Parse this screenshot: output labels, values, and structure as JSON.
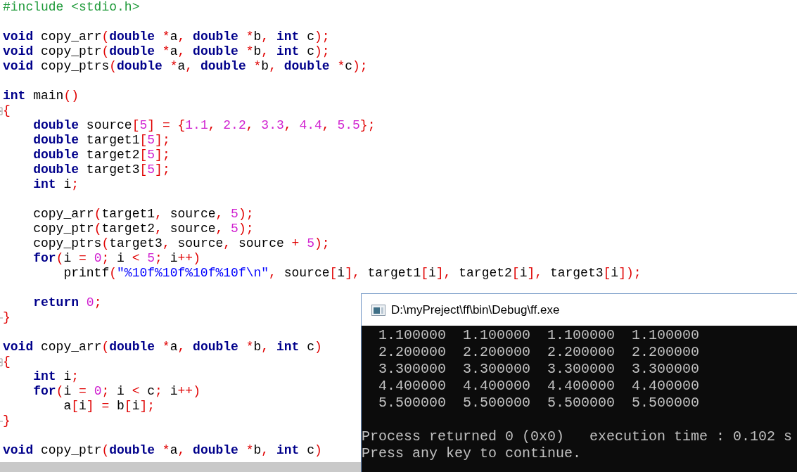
{
  "editor": {
    "lines": [
      {
        "kind": "code",
        "tokens": [
          {
            "kind": "pre",
            "text": "#include <stdio.h>"
          }
        ]
      },
      {
        "kind": "blank"
      },
      {
        "kind": "code",
        "tokens": [
          {
            "kind": "kw",
            "text": "void"
          },
          {
            "kind": "id",
            "text": " copy_arr"
          },
          {
            "kind": "op",
            "text": "("
          },
          {
            "kind": "kw",
            "text": "double"
          },
          {
            "kind": "op",
            "text": " *"
          },
          {
            "kind": "id",
            "text": "a"
          },
          {
            "kind": "op",
            "text": ","
          },
          {
            "kind": "kw",
            "text": " double"
          },
          {
            "kind": "op",
            "text": " *"
          },
          {
            "kind": "id",
            "text": "b"
          },
          {
            "kind": "op",
            "text": ","
          },
          {
            "kind": "kw",
            "text": " int"
          },
          {
            "kind": "id",
            "text": " c"
          },
          {
            "kind": "op",
            "text": ");"
          }
        ]
      },
      {
        "kind": "code",
        "tokens": [
          {
            "kind": "kw",
            "text": "void"
          },
          {
            "kind": "id",
            "text": " copy_ptr"
          },
          {
            "kind": "op",
            "text": "("
          },
          {
            "kind": "kw",
            "text": "double"
          },
          {
            "kind": "op",
            "text": " *"
          },
          {
            "kind": "id",
            "text": "a"
          },
          {
            "kind": "op",
            "text": ","
          },
          {
            "kind": "kw",
            "text": " double"
          },
          {
            "kind": "op",
            "text": " *"
          },
          {
            "kind": "id",
            "text": "b"
          },
          {
            "kind": "op",
            "text": ","
          },
          {
            "kind": "kw",
            "text": " int"
          },
          {
            "kind": "id",
            "text": " c"
          },
          {
            "kind": "op",
            "text": ");"
          }
        ]
      },
      {
        "kind": "code",
        "tokens": [
          {
            "kind": "kw",
            "text": "void"
          },
          {
            "kind": "id",
            "text": " copy_ptrs"
          },
          {
            "kind": "op",
            "text": "("
          },
          {
            "kind": "kw",
            "text": "double"
          },
          {
            "kind": "op",
            "text": " *"
          },
          {
            "kind": "id",
            "text": "a"
          },
          {
            "kind": "op",
            "text": ","
          },
          {
            "kind": "kw",
            "text": " double"
          },
          {
            "kind": "op",
            "text": " *"
          },
          {
            "kind": "id",
            "text": "b"
          },
          {
            "kind": "op",
            "text": ","
          },
          {
            "kind": "kw",
            "text": " double"
          },
          {
            "kind": "op",
            "text": " *"
          },
          {
            "kind": "id",
            "text": "c"
          },
          {
            "kind": "op",
            "text": ");"
          }
        ]
      },
      {
        "kind": "blank"
      },
      {
        "kind": "code",
        "tokens": [
          {
            "kind": "kw",
            "text": "int"
          },
          {
            "kind": "id",
            "text": " main"
          },
          {
            "kind": "op",
            "text": "()"
          }
        ]
      },
      {
        "kind": "block_open",
        "tokens": [
          {
            "kind": "op",
            "text": "{"
          }
        ]
      },
      {
        "kind": "code",
        "tokens": [
          {
            "kind": "kw",
            "text": "    double"
          },
          {
            "kind": "id",
            "text": " source"
          },
          {
            "kind": "op",
            "text": "["
          },
          {
            "kind": "num",
            "text": "5"
          },
          {
            "kind": "op",
            "text": "] = {"
          },
          {
            "kind": "num",
            "text": "1.1"
          },
          {
            "kind": "op",
            "text": ","
          },
          {
            "kind": "num",
            "text": " 2.2"
          },
          {
            "kind": "op",
            "text": ","
          },
          {
            "kind": "num",
            "text": " 3.3"
          },
          {
            "kind": "op",
            "text": ","
          },
          {
            "kind": "num",
            "text": " 4.4"
          },
          {
            "kind": "op",
            "text": ","
          },
          {
            "kind": "num",
            "text": " 5.5"
          },
          {
            "kind": "op",
            "text": "};"
          }
        ]
      },
      {
        "kind": "code",
        "tokens": [
          {
            "kind": "kw",
            "text": "    double"
          },
          {
            "kind": "id",
            "text": " target1"
          },
          {
            "kind": "op",
            "text": "["
          },
          {
            "kind": "num",
            "text": "5"
          },
          {
            "kind": "op",
            "text": "];"
          }
        ]
      },
      {
        "kind": "code",
        "tokens": [
          {
            "kind": "kw",
            "text": "    double"
          },
          {
            "kind": "id",
            "text": " target2"
          },
          {
            "kind": "op",
            "text": "["
          },
          {
            "kind": "num",
            "text": "5"
          },
          {
            "kind": "op",
            "text": "];"
          }
        ]
      },
      {
        "kind": "code",
        "tokens": [
          {
            "kind": "kw",
            "text": "    double"
          },
          {
            "kind": "id",
            "text": " target3"
          },
          {
            "kind": "op",
            "text": "["
          },
          {
            "kind": "num",
            "text": "5"
          },
          {
            "kind": "op",
            "text": "];"
          }
        ]
      },
      {
        "kind": "code",
        "tokens": [
          {
            "kind": "kw",
            "text": "    int"
          },
          {
            "kind": "id",
            "text": " i"
          },
          {
            "kind": "op",
            "text": ";"
          }
        ]
      },
      {
        "kind": "blank"
      },
      {
        "kind": "code",
        "tokens": [
          {
            "kind": "id",
            "text": "    copy_arr"
          },
          {
            "kind": "op",
            "text": "("
          },
          {
            "kind": "id",
            "text": "target1"
          },
          {
            "kind": "op",
            "text": ","
          },
          {
            "kind": "id",
            "text": " source"
          },
          {
            "kind": "op",
            "text": ","
          },
          {
            "kind": "num",
            "text": " 5"
          },
          {
            "kind": "op",
            "text": ");"
          }
        ]
      },
      {
        "kind": "code",
        "tokens": [
          {
            "kind": "id",
            "text": "    copy_ptr"
          },
          {
            "kind": "op",
            "text": "("
          },
          {
            "kind": "id",
            "text": "target2"
          },
          {
            "kind": "op",
            "text": ","
          },
          {
            "kind": "id",
            "text": " source"
          },
          {
            "kind": "op",
            "text": ","
          },
          {
            "kind": "num",
            "text": " 5"
          },
          {
            "kind": "op",
            "text": ");"
          }
        ]
      },
      {
        "kind": "code",
        "tokens": [
          {
            "kind": "id",
            "text": "    copy_ptrs"
          },
          {
            "kind": "op",
            "text": "("
          },
          {
            "kind": "id",
            "text": "target3"
          },
          {
            "kind": "op",
            "text": ","
          },
          {
            "kind": "id",
            "text": " source"
          },
          {
            "kind": "op",
            "text": ","
          },
          {
            "kind": "id",
            "text": " source"
          },
          {
            "kind": "op",
            "text": " +"
          },
          {
            "kind": "num",
            "text": " 5"
          },
          {
            "kind": "op",
            "text": ");"
          }
        ]
      },
      {
        "kind": "code",
        "tokens": [
          {
            "kind": "kw",
            "text": "    for"
          },
          {
            "kind": "op",
            "text": "("
          },
          {
            "kind": "id",
            "text": "i"
          },
          {
            "kind": "op",
            "text": " ="
          },
          {
            "kind": "num",
            "text": " 0"
          },
          {
            "kind": "op",
            "text": ";"
          },
          {
            "kind": "id",
            "text": " i"
          },
          {
            "kind": "op",
            "text": " <"
          },
          {
            "kind": "num",
            "text": " 5"
          },
          {
            "kind": "op",
            "text": ";"
          },
          {
            "kind": "id",
            "text": " i"
          },
          {
            "kind": "op",
            "text": "++)"
          }
        ]
      },
      {
        "kind": "code",
        "tokens": [
          {
            "kind": "id",
            "text": "        printf"
          },
          {
            "kind": "op",
            "text": "("
          },
          {
            "kind": "str",
            "text": "\"%10f%10f%10f%10f\\n\""
          },
          {
            "kind": "op",
            "text": ","
          },
          {
            "kind": "id",
            "text": " source"
          },
          {
            "kind": "op",
            "text": "["
          },
          {
            "kind": "id",
            "text": "i"
          },
          {
            "kind": "op",
            "text": "],"
          },
          {
            "kind": "id",
            "text": " target1"
          },
          {
            "kind": "op",
            "text": "["
          },
          {
            "kind": "id",
            "text": "i"
          },
          {
            "kind": "op",
            "text": "],"
          },
          {
            "kind": "id",
            "text": " target2"
          },
          {
            "kind": "op",
            "text": "["
          },
          {
            "kind": "id",
            "text": "i"
          },
          {
            "kind": "op",
            "text": "],"
          },
          {
            "kind": "id",
            "text": " target3"
          },
          {
            "kind": "op",
            "text": "["
          },
          {
            "kind": "id",
            "text": "i"
          },
          {
            "kind": "op",
            "text": "]);"
          }
        ]
      },
      {
        "kind": "blank"
      },
      {
        "kind": "code",
        "tokens": [
          {
            "kind": "kw",
            "text": "    return"
          },
          {
            "kind": "num",
            "text": " 0"
          },
          {
            "kind": "op",
            "text": ";"
          }
        ]
      },
      {
        "kind": "block_close",
        "tokens": [
          {
            "kind": "op",
            "text": "}"
          }
        ]
      },
      {
        "kind": "blank"
      },
      {
        "kind": "code",
        "tokens": [
          {
            "kind": "kw",
            "text": "void"
          },
          {
            "kind": "id",
            "text": " copy_arr"
          },
          {
            "kind": "op",
            "text": "("
          },
          {
            "kind": "kw",
            "text": "double"
          },
          {
            "kind": "op",
            "text": " *"
          },
          {
            "kind": "id",
            "text": "a"
          },
          {
            "kind": "op",
            "text": ","
          },
          {
            "kind": "kw",
            "text": " double"
          },
          {
            "kind": "op",
            "text": " *"
          },
          {
            "kind": "id",
            "text": "b"
          },
          {
            "kind": "op",
            "text": ","
          },
          {
            "kind": "kw",
            "text": " int"
          },
          {
            "kind": "id",
            "text": " c"
          },
          {
            "kind": "op",
            "text": ")"
          }
        ]
      },
      {
        "kind": "block_open",
        "tokens": [
          {
            "kind": "op",
            "text": "{"
          }
        ]
      },
      {
        "kind": "code",
        "tokens": [
          {
            "kind": "kw",
            "text": "    int"
          },
          {
            "kind": "id",
            "text": " i"
          },
          {
            "kind": "op",
            "text": ";"
          }
        ]
      },
      {
        "kind": "code",
        "tokens": [
          {
            "kind": "kw",
            "text": "    for"
          },
          {
            "kind": "op",
            "text": "("
          },
          {
            "kind": "id",
            "text": "i"
          },
          {
            "kind": "op",
            "text": " ="
          },
          {
            "kind": "num",
            "text": " 0"
          },
          {
            "kind": "op",
            "text": ";"
          },
          {
            "kind": "id",
            "text": " i"
          },
          {
            "kind": "op",
            "text": " <"
          },
          {
            "kind": "id",
            "text": " c"
          },
          {
            "kind": "op",
            "text": ";"
          },
          {
            "kind": "id",
            "text": " i"
          },
          {
            "kind": "op",
            "text": "++)"
          }
        ]
      },
      {
        "kind": "code",
        "tokens": [
          {
            "kind": "id",
            "text": "        a"
          },
          {
            "kind": "op",
            "text": "["
          },
          {
            "kind": "id",
            "text": "i"
          },
          {
            "kind": "op",
            "text": "] ="
          },
          {
            "kind": "id",
            "text": " b"
          },
          {
            "kind": "op",
            "text": "["
          },
          {
            "kind": "id",
            "text": "i"
          },
          {
            "kind": "op",
            "text": "];"
          }
        ]
      },
      {
        "kind": "block_close",
        "tokens": [
          {
            "kind": "op",
            "text": "}"
          }
        ]
      },
      {
        "kind": "blank"
      },
      {
        "kind": "code",
        "tokens": [
          {
            "kind": "kw",
            "text": "void"
          },
          {
            "kind": "id",
            "text": " copy_ptr"
          },
          {
            "kind": "op",
            "text": "("
          },
          {
            "kind": "kw",
            "text": "double"
          },
          {
            "kind": "op",
            "text": " *"
          },
          {
            "kind": "id",
            "text": "a"
          },
          {
            "kind": "op",
            "text": ","
          },
          {
            "kind": "kw",
            "text": " double"
          },
          {
            "kind": "op",
            "text": " *"
          },
          {
            "kind": "id",
            "text": "b"
          },
          {
            "kind": "op",
            "text": ","
          },
          {
            "kind": "kw",
            "text": " int"
          },
          {
            "kind": "id",
            "text": " c"
          },
          {
            "kind": "op",
            "text": ")"
          }
        ]
      }
    ]
  },
  "console": {
    "title": "D:\\myPreject\\ff\\bin\\Debug\\ff.exe",
    "output_lines": [
      "  1.100000  1.100000  1.100000  1.100000",
      "  2.200000  2.200000  2.200000  2.200000",
      "  3.300000  3.300000  3.300000  3.300000",
      "  4.400000  4.400000  4.400000  4.400000",
      "  5.500000  5.500000  5.500000  5.500000"
    ],
    "status_lines": [
      "Process returned 0 (0x0)   execution time : 0.102 s",
      "Press any key to continue."
    ]
  }
}
